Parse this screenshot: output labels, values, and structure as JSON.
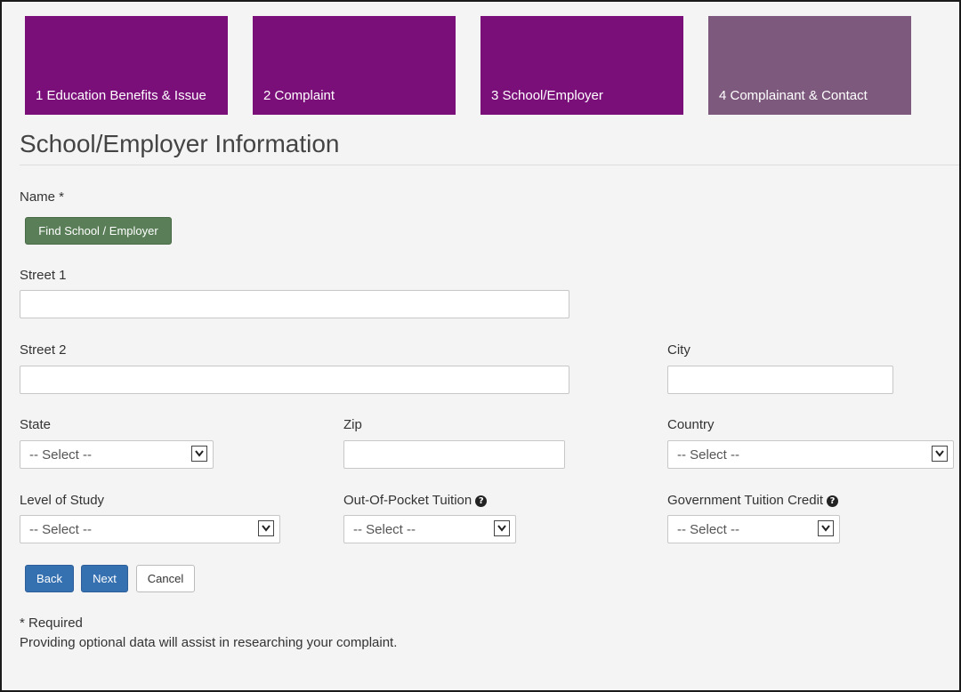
{
  "steps": [
    {
      "label": "1 Education Benefits & Issue"
    },
    {
      "label": "2 Complaint"
    },
    {
      "label": "3 School/Employer"
    },
    {
      "label": "4 Complainant & Contact"
    }
  ],
  "page_title": "School/Employer Information",
  "form": {
    "name_label": "Name *",
    "find_button": "Find School / Employer",
    "street1_label": "Street 1",
    "street1_value": "",
    "street2_label": "Street 2",
    "street2_value": "",
    "city_label": "City",
    "city_value": "",
    "state_label": "State",
    "state_value": "-- Select --",
    "zip_label": "Zip",
    "zip_value": "",
    "country_label": "Country",
    "country_value": "-- Select --",
    "level_label": "Level of Study",
    "level_value": "-- Select --",
    "oop_label": "Out-Of-Pocket Tuition",
    "oop_value": "-- Select --",
    "gov_label": "Government Tuition Credit",
    "gov_value": "-- Select --"
  },
  "buttons": {
    "back": "Back",
    "next": "Next",
    "cancel": "Cancel"
  },
  "footer": {
    "required_note": "* Required",
    "optional_note": "Providing optional data will assist in researching your complaint."
  },
  "colors": {
    "step_active": "#7a0f7a",
    "step_inactive": "#7d5a7d",
    "find_button": "#5a7f58",
    "primary_button": "#3570b0"
  }
}
